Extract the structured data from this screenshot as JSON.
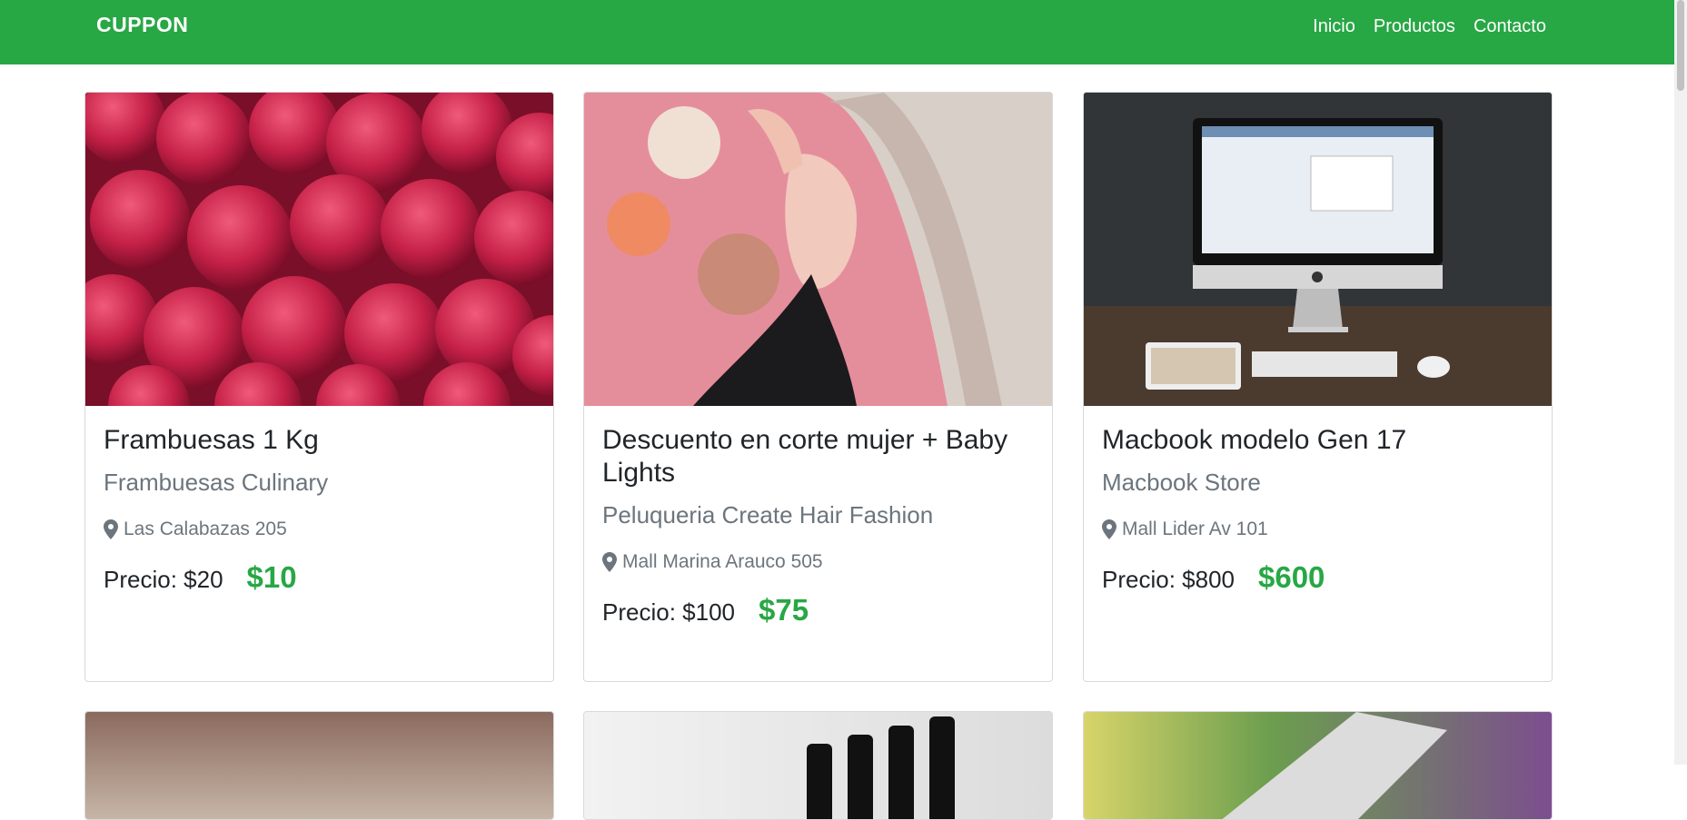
{
  "brand": "CUPPON",
  "nav": [
    "Inicio",
    "Productos",
    "Contacto"
  ],
  "products": [
    {
      "title": "Frambuesas 1 Kg",
      "company": "Frambuesas Culinary",
      "address": "Las Calabazas 205",
      "old_price": "Precio: $20",
      "new_price": "$10",
      "image_icon": "raspberries-image"
    },
    {
      "title": "Descuento en corte mujer + Baby Lights",
      "company": "Peluqueria Create Hair Fashion",
      "address": "Mall Marina Arauco 505",
      "old_price": "Precio: $100",
      "new_price": "$75",
      "image_icon": "woman-portrait-image"
    },
    {
      "title": "Macbook modelo Gen 17",
      "company": "Macbook Store",
      "address": "Mall Lider Av 101",
      "old_price": "Precio: $800",
      "new_price": "$600",
      "image_icon": "imac-computer-image"
    }
  ],
  "colors": {
    "navbar": "#28a745",
    "price": "#28a745",
    "muted": "#6c757d"
  }
}
